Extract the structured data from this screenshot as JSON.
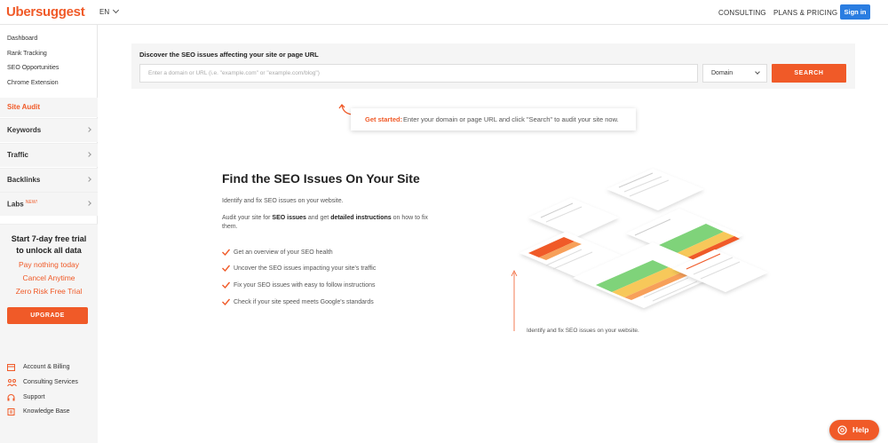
{
  "header": {
    "logo": "Ubersuggest",
    "language": "EN",
    "nav": [
      "CONSULTING",
      "PLANS & PRICING"
    ],
    "signin_label": "Sign in"
  },
  "sidebar": {
    "small_links": [
      "Dashboard",
      "Rank Tracking",
      "SEO Opportunities",
      "Chrome Extension"
    ],
    "active_item": "Site Audit",
    "sections": [
      {
        "label": "Keywords",
        "badge": ""
      },
      {
        "label": "Traffic",
        "badge": ""
      },
      {
        "label": "Backlinks",
        "badge": ""
      },
      {
        "label": "Labs",
        "badge": "NEW!"
      }
    ],
    "trial": {
      "title_line1": "Start 7-day free trial",
      "title_line2": "to unlock all data",
      "lines": [
        "Pay nothing today",
        "Cancel Anytime",
        "Zero Risk Free Trial"
      ],
      "upgrade_label": "UPGRADE"
    },
    "bottom_links": [
      {
        "label": "Account & Billing",
        "icon": "billing-icon"
      },
      {
        "label": "Consulting Services",
        "icon": "consulting-icon"
      },
      {
        "label": "Support",
        "icon": "headset-icon"
      },
      {
        "label": "Knowledge Base",
        "icon": "book-icon"
      }
    ]
  },
  "search": {
    "title": "Discover the SEO issues affecting your site or page URL",
    "placeholder": "Enter a domain or URL (i.e. \"example.com\" or \"example.com/blog\")",
    "select_value": "Domain",
    "button_label": "SEARCH"
  },
  "get_started": {
    "label": "Get started:",
    "text": "Enter your domain or page URL and click \"Search\" to audit your site now."
  },
  "feature": {
    "title": "Find the SEO Issues On Your Site",
    "p1": "Identify and fix SEO issues on your website.",
    "p2_pre": "Audit your site for ",
    "p2_b1": "SEO issues",
    "p2_mid": " and get ",
    "p2_b2": "detailed instructions",
    "p2_post": " on how to fix them.",
    "checks": [
      "Get an overview of your SEO health",
      "Uncover the SEO issues impacting your site's traffic",
      "Fix your SEO issues with easy to follow instructions",
      "Check if your site speed meets Google's standards"
    ],
    "caption": "Identify and fix SEO issues on your website."
  },
  "help": {
    "label": "Help"
  },
  "colors": {
    "accent": "#f05a28",
    "signin": "#2a7de1",
    "panel": "#f5f5f5"
  }
}
